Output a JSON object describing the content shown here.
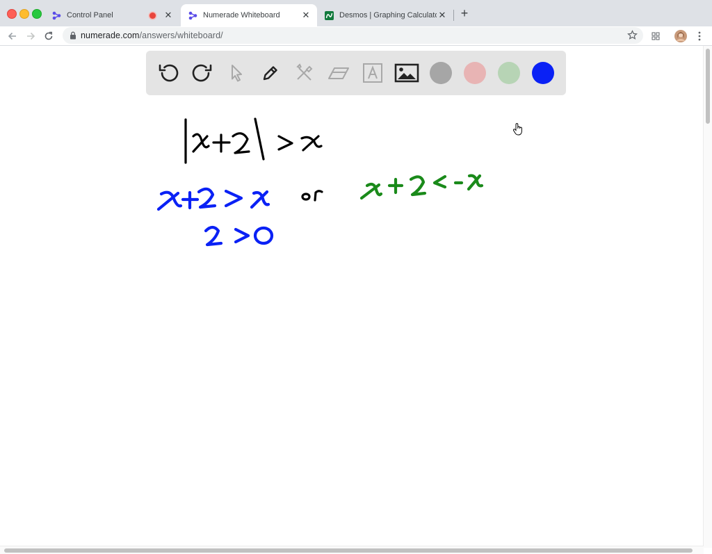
{
  "tabs": [
    {
      "title": "Control Panel",
      "favicon": "numerade-icon",
      "recording": true
    },
    {
      "title": "Numerade Whiteboard",
      "favicon": "numerade-icon",
      "active": true
    },
    {
      "title": "Desmos | Graphing Calculator",
      "favicon": "desmos-icon"
    }
  ],
  "address": {
    "host": "numerade.com",
    "path": "/answers/whiteboard/"
  },
  "whiteboard": {
    "tools": [
      "undo-icon",
      "redo-icon",
      "pointer-icon",
      "pen-icon",
      "tools-icon",
      "eraser-icon",
      "text-icon",
      "image-icon"
    ],
    "colors": {
      "gray": "#a6a6a6",
      "pink": "#e8b4b4",
      "green": "#b7d4b5",
      "blue": "#0a21f5"
    },
    "ink_colors": {
      "black": "#000000",
      "blue": "#0a21f5",
      "green": "#1a8a1a"
    }
  }
}
